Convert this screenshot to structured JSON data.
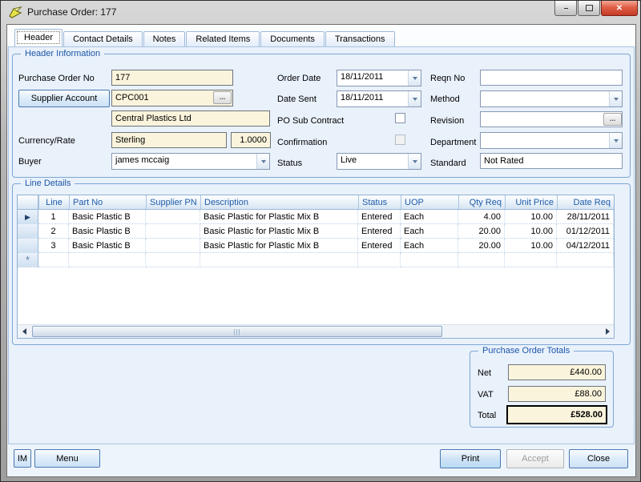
{
  "window": {
    "title": "Purchase Order: 177",
    "minimize_glyph": "–",
    "close_glyph": "✕"
  },
  "tabs": [
    {
      "label": "Header",
      "selected": true
    },
    {
      "label": "Contact Details",
      "selected": false
    },
    {
      "label": "Notes",
      "selected": false
    },
    {
      "label": "Related Items",
      "selected": false
    },
    {
      "label": "Documents",
      "selected": false
    },
    {
      "label": "Transactions",
      "selected": false
    }
  ],
  "header_info": {
    "title": "Header Information",
    "purchase_order_no": {
      "label": "Purchase Order No",
      "value": "177"
    },
    "supplier_account": {
      "button_label": "Supplier Account",
      "code": "CPC001",
      "name": "Central Plastics Ltd",
      "browse_glyph": "..."
    },
    "currency_rate": {
      "label": "Currency/Rate",
      "currency": "Sterling",
      "rate": "1.0000"
    },
    "buyer": {
      "label": "Buyer",
      "value": "james mccaig"
    },
    "order_date": {
      "label": "Order Date",
      "value": "18/11/2011"
    },
    "date_sent": {
      "label": "Date Sent",
      "value": "18/11/2011"
    },
    "po_sub_contract": {
      "label": "PO Sub Contract",
      "checked": false
    },
    "confirmation": {
      "label": "Confirmation",
      "checked": false
    },
    "status": {
      "label": "Status",
      "value": "Live"
    },
    "reqn_no": {
      "label": "Reqn No",
      "value": ""
    },
    "method": {
      "label": "Method",
      "value": ""
    },
    "revision": {
      "label": "Revision",
      "value": "",
      "browse_glyph": "..."
    },
    "department": {
      "label": "Department",
      "value": ""
    },
    "standard": {
      "label": "Standard",
      "value": "Not Rated"
    }
  },
  "line_details": {
    "title": "Line Details",
    "columns": [
      "Line",
      "Part No",
      "Supplier PN",
      "Description",
      "Status",
      "UOP",
      "Qty Req",
      "Unit Price",
      "Date Req"
    ],
    "current_row_marker": "▶",
    "new_row_marker": "*",
    "rows": [
      {
        "line": "1",
        "part_no": "Basic Plastic B",
        "supplier_pn": "",
        "description": "Basic Plastic for Plastic Mix B",
        "status": "Entered",
        "uop": "Each",
        "qty_req": "4.00",
        "unit_price": "10.00",
        "date_req": "28/11/2011"
      },
      {
        "line": "2",
        "part_no": "Basic Plastic B",
        "supplier_pn": "",
        "description": "Basic Plastic for Plastic Mix B",
        "status": "Entered",
        "uop": "Each",
        "qty_req": "20.00",
        "unit_price": "10.00",
        "date_req": "01/12/2011"
      },
      {
        "line": "3",
        "part_no": "Basic Plastic B",
        "supplier_pn": "",
        "description": "Basic Plastic for Plastic Mix B",
        "status": "Entered",
        "uop": "Each",
        "qty_req": "20.00",
        "unit_price": "10.00",
        "date_req": "04/12/2011"
      }
    ]
  },
  "totals": {
    "title": "Purchase Order Totals",
    "net_label": "Net",
    "net_value": "£440.00",
    "vat_label": "VAT",
    "vat_value": "£88.00",
    "total_label": "Total",
    "total_value": "£528.00"
  },
  "footer": {
    "im": "IM",
    "menu": "Menu",
    "print": "Print",
    "accept": "Accept",
    "close": "Close"
  },
  "colors": {
    "field_cream": "#fbf4dc",
    "group_label_blue": "#1c56a8",
    "button_border_blue": "#4a78b2",
    "grid_header_text": "#1e5caa",
    "close_button_red": "#c33a24",
    "page_background": "#e9f1fb"
  }
}
